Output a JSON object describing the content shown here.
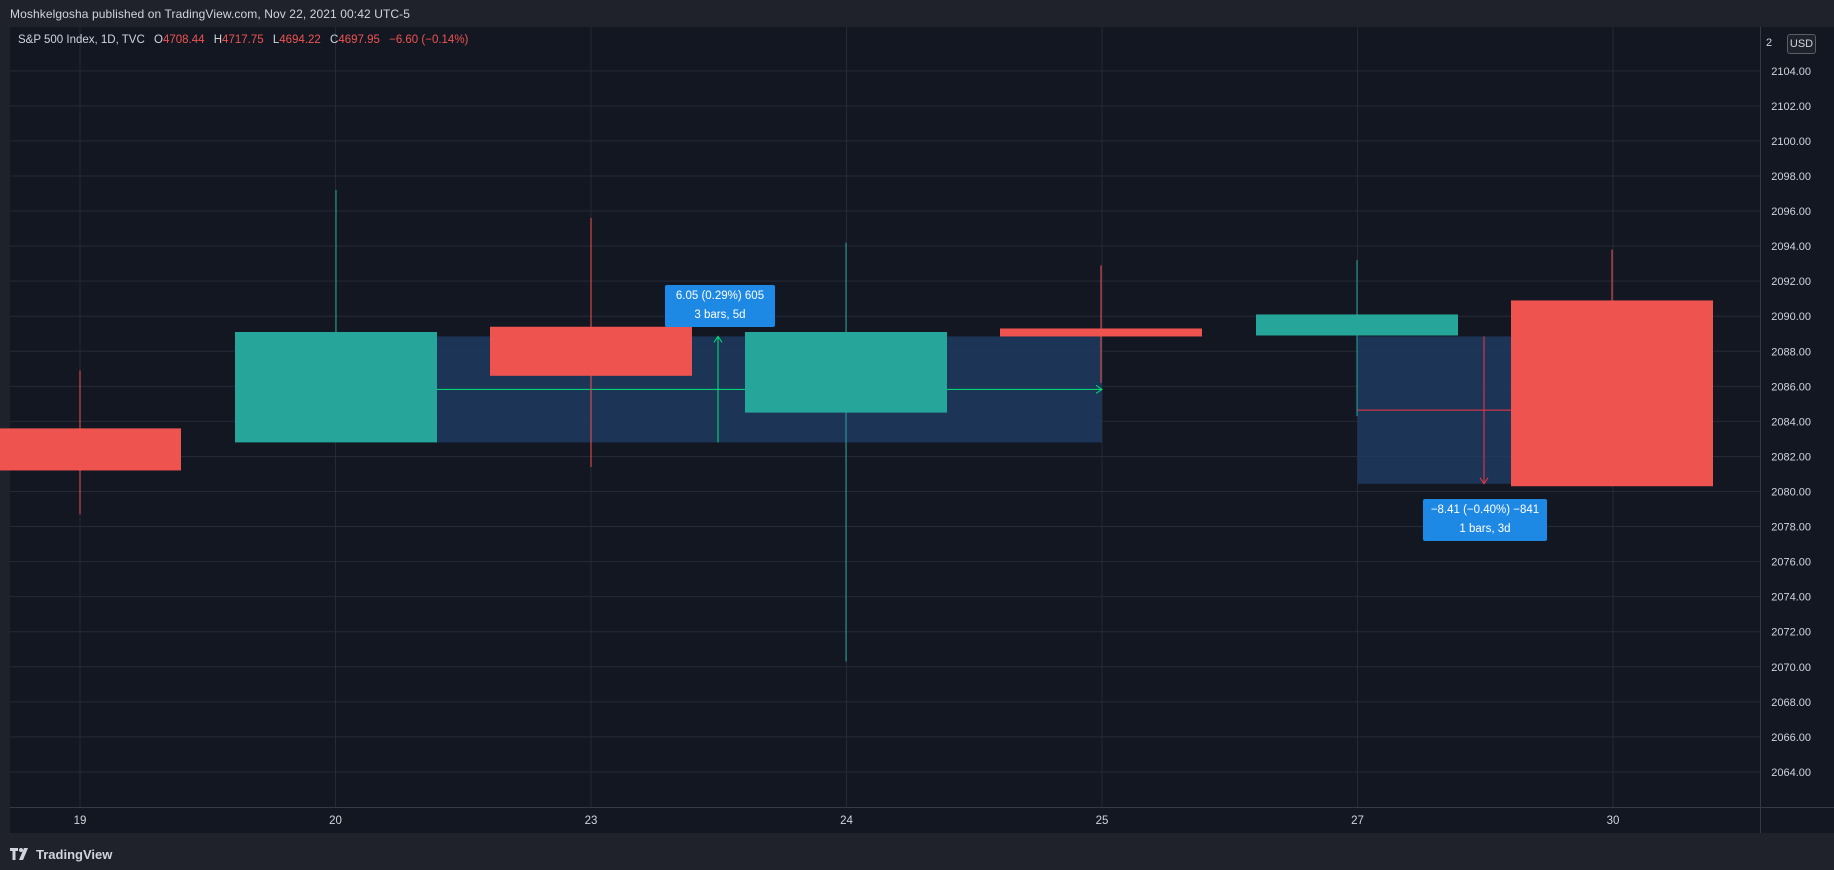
{
  "header": {
    "published_text": "Moshkelgosha published on TradingView.com, Nov 22, 2021 00:42 UTC-5"
  },
  "legend": {
    "symbol": "S&P 500 Index, 1D, TVC",
    "open_key": "O",
    "open": "4708.44",
    "high_key": "H",
    "high": "4717.75",
    "low_key": "L",
    "low": "4694.22",
    "close_key": "C",
    "close": "4697.95",
    "change": "−6.60 (−0.14%)"
  },
  "price_axis": {
    "currency_badge": "USD",
    "top_label_clipped": "2"
  },
  "footer": {
    "brand": "TradingView"
  },
  "measure_tooltips": [
    {
      "line1": "6.05 (0.29%) 605",
      "line2": "3 bars, 5d"
    },
    {
      "line1": "−8.41 (−0.40%) −841",
      "line2": "1 bars, 3d"
    }
  ],
  "colors": {
    "background": "#131722",
    "grid": "#262a36",
    "up": "#26a69a",
    "down": "#ef5350",
    "measure_fill": "#1e3a5f",
    "measure_line_up": "#00e676",
    "measure_line_down": "#f23645",
    "tooltip": "#1e88e5"
  },
  "chart_data": {
    "type": "candlestick",
    "title": "S&P 500 Index, 1D, TVC",
    "x_categories": [
      "19",
      "20",
      "23",
      "24",
      "25",
      "27",
      "30"
    ],
    "y_ticks": [
      2064,
      2066,
      2068,
      2070,
      2072,
      2074,
      2076,
      2078,
      2080,
      2082,
      2084,
      2086,
      2088,
      2090,
      2092,
      2094,
      2096,
      2098,
      2100,
      2102,
      2104
    ],
    "ylim": [
      2062,
      2106.5
    ],
    "candles": [
      {
        "x": 18.9,
        "open": 2083.6,
        "high": 2086.9,
        "low": 2078.7,
        "close": 2081.2
      },
      {
        "x": 20,
        "open": 2082.8,
        "high": 2097.2,
        "low": 2082.8,
        "close": 2089.1
      },
      {
        "x": 22.9,
        "open": 2089.4,
        "high": 2095.6,
        "low": 2081.4,
        "close": 2086.6
      },
      {
        "x": 24,
        "open": 2084.5,
        "high": 2094.2,
        "low": 2070.3,
        "close": 2089.1
      },
      {
        "x": 25,
        "open": 2089.3,
        "high": 2092.9,
        "low": 2086.2,
        "close": 2088.9
      },
      {
        "x": 27,
        "open": 2088.9,
        "high": 2093.2,
        "low": 2084.3,
        "close": 2090.1
      },
      {
        "x": 30,
        "open": 2090.9,
        "high": 2093.8,
        "low": 2080.3,
        "close": 2080.3
      }
    ],
    "measurements": [
      {
        "from_price": 2082.8,
        "to_price": 2088.85,
        "change": "6.05 (0.29%) 605",
        "span": "3 bars, 5d",
        "direction": "up"
      },
      {
        "from_price": 2088.85,
        "to_price": 2080.44,
        "change": "−8.41 (−0.40%) −841",
        "span": "1 bars, 3d",
        "direction": "down"
      }
    ],
    "price_label_format": "2 decimals",
    "grid": true
  }
}
